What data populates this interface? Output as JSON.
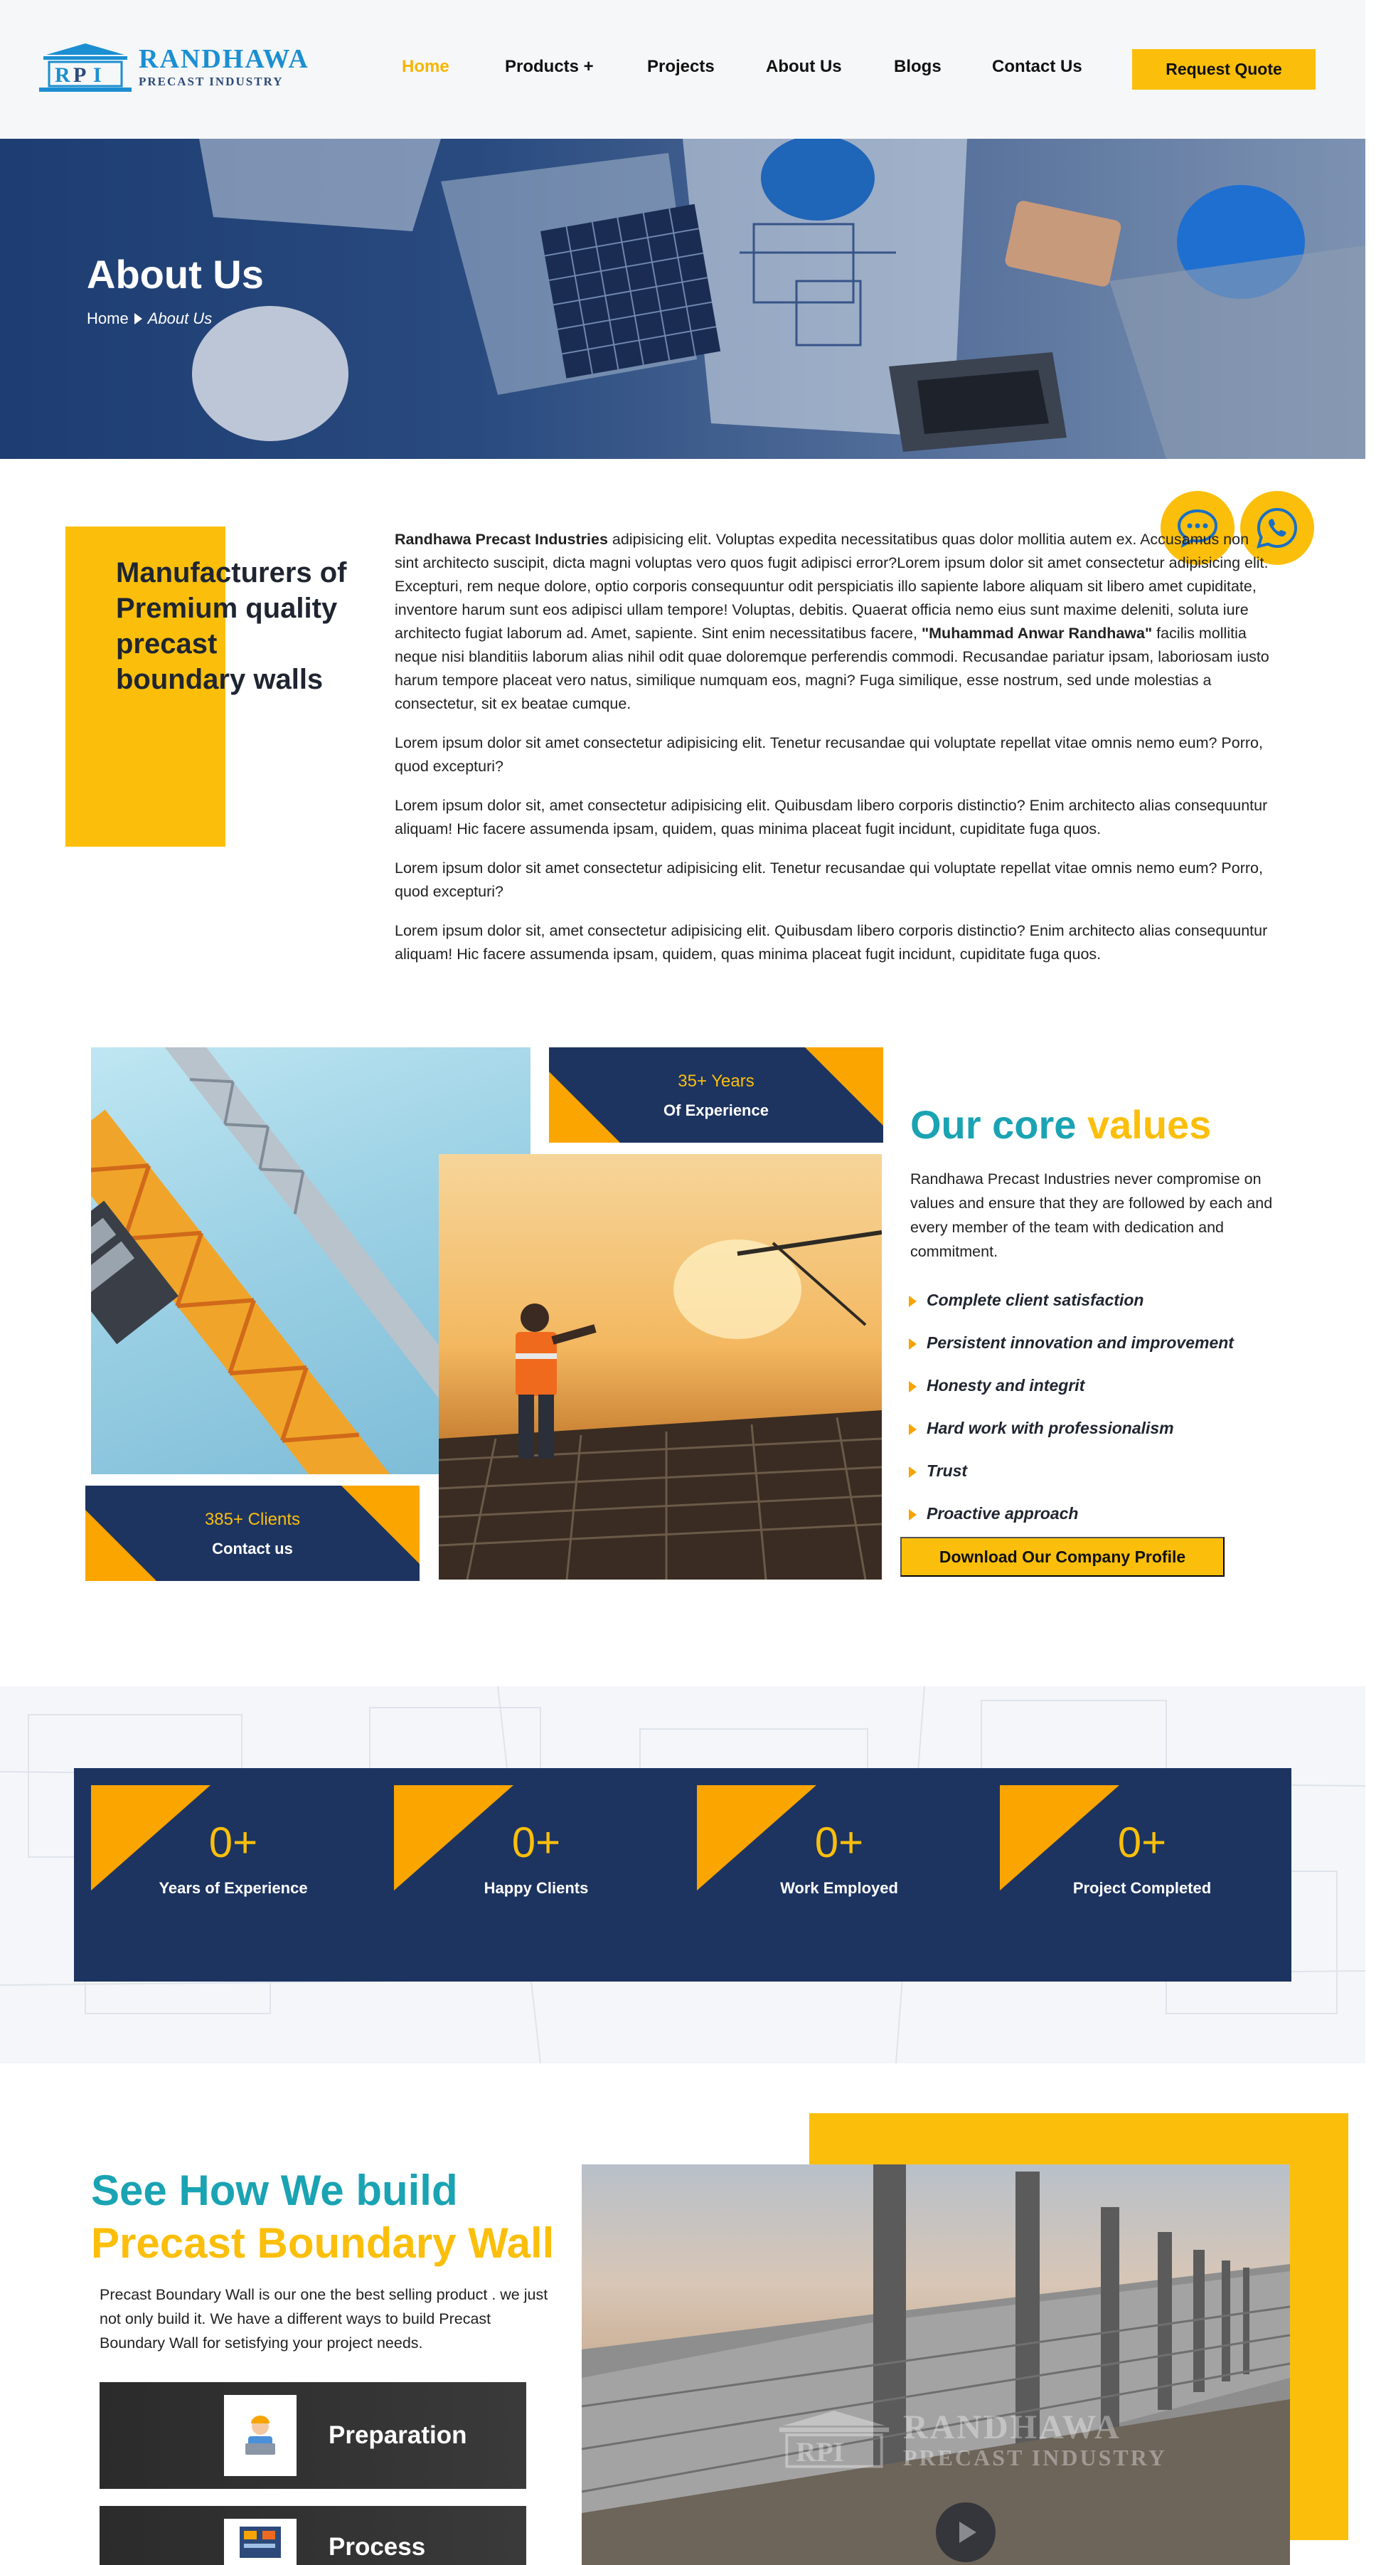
{
  "brand": {
    "name": "RANDHAWA",
    "subtitle": "PRECAST INDUSTRY",
    "logo_letters": "RPI"
  },
  "nav": {
    "items": [
      "Home",
      "Products +",
      "Projects",
      "About Us",
      "Blogs",
      "Contact Us"
    ],
    "active": "Home",
    "cta": "Request Quote"
  },
  "hero": {
    "title": "About Us",
    "breadcrumb": {
      "home": "Home",
      "current": "About Us"
    }
  },
  "floating": {
    "chat_icon": "chat-bubble-icon",
    "whatsapp_icon": "whatsapp-icon"
  },
  "about": {
    "heading": "Manufacturers of Premium quality precast boundary walls",
    "p1_lead": "Randhawa Precast Industries",
    "p1_a": " adipisicing elit. Voluptas expedita necessitatibus quas dolor mollitia autem ex. Accusamus non sint architecto suscipit, dicta magni voluptas vero quos fugit adipisci error?Lorem ipsum dolor sit amet consectetur adipisicing elit. Excepturi, rem neque dolore, optio corporis consequuntur odit perspiciatis illo sapiente labore aliquam sit libero amet cupiditate, inventore harum sunt eos adipisci ullam tempore! Voluptas, debitis. Quaerat officia nemo eius sunt maxime deleniti, soluta iure architecto fugiat laborum ad. Amet, sapiente. Sint enim necessitatibus facere, ",
    "p1_quote": "\"Muhammad Anwar Randhawa\"",
    "p1_b": " facilis mollitia neque nisi blanditiis laborum alias nihil odit quae doloremque perferendis commodi. Recusandae pariatur ipsam, laboriosam iusto harum tempore placeat vero natus, similique numquam eos, magni? Fuga similique, esse nostrum, sed unde molestias a consectetur, sit ex beatae cumque.",
    "p2": "Lorem ipsum dolor sit amet consectetur adipisicing elit. Tenetur recusandae qui voluptate repellat vitae omnis nemo eum? Porro, quod excepturi?",
    "p3": "Lorem ipsum dolor sit, amet consectetur adipisicing elit. Quibusdam libero corporis distinctio? Enim architecto alias consequuntur aliquam! Hic facere assumenda ipsam, quidem, quas minima placeat fugit incidunt, cupiditate fuga quos.",
    "p4": "Lorem ipsum dolor sit amet consectetur adipisicing elit. Tenetur recusandae qui voluptate repellat vitae omnis nemo eum? Porro, quod excepturi?",
    "p5": "Lorem ipsum dolor sit, amet consectetur adipisicing elit. Quibusdam libero corporis distinctio? Enim architecto alias consequuntur aliquam! Hic facere assumenda ipsam, quidem, quas minima placeat fugit incidunt, cupiditate fuga quos."
  },
  "badges": {
    "years": {
      "value": "35+ Years",
      "label": "Of Experience"
    },
    "clients": {
      "value": "385+ Clients",
      "label": "Contact us"
    }
  },
  "core": {
    "title_a": "Our core ",
    "title_b": "values",
    "desc": "Randhawa Precast Industries never compromise on values and ensure that they are followed by each and every member of the team with dedication and commitment.",
    "values": [
      "Complete client satisfaction",
      "Persistent innovation and improvement",
      "Honesty and integrit",
      "Hard work with professionalism",
      "Trust",
      "Proactive approach"
    ],
    "download": "Download Our Company Profile"
  },
  "stats": [
    {
      "value": "0+",
      "label": "Years of Experience"
    },
    {
      "value": "0+",
      "label": "Happy Clients"
    },
    {
      "value": "0+",
      "label": "Work Employed"
    },
    {
      "value": "0+",
      "label": "Project Completed"
    }
  ],
  "build": {
    "title_1": "See How We build",
    "title_2": "Precast Boundary Wall",
    "desc": "Precast Boundary Wall is our one the best selling product . we just not only build it. We have a different ways to build Precast Boundary Wall for setisfying your project needs.",
    "steps": [
      {
        "label": "Preparation",
        "icon": "worker-laptop-icon"
      },
      {
        "label": "Process",
        "icon": "process-board-icon"
      }
    ],
    "video_watermark": {
      "name": "RANDHAWA",
      "subtitle": "PRECAST INDUSTRY"
    }
  },
  "colors": {
    "accent": "#fbbf0b",
    "navy": "#1d3461",
    "teal": "#1aa3b3",
    "orange": "#fba500"
  }
}
